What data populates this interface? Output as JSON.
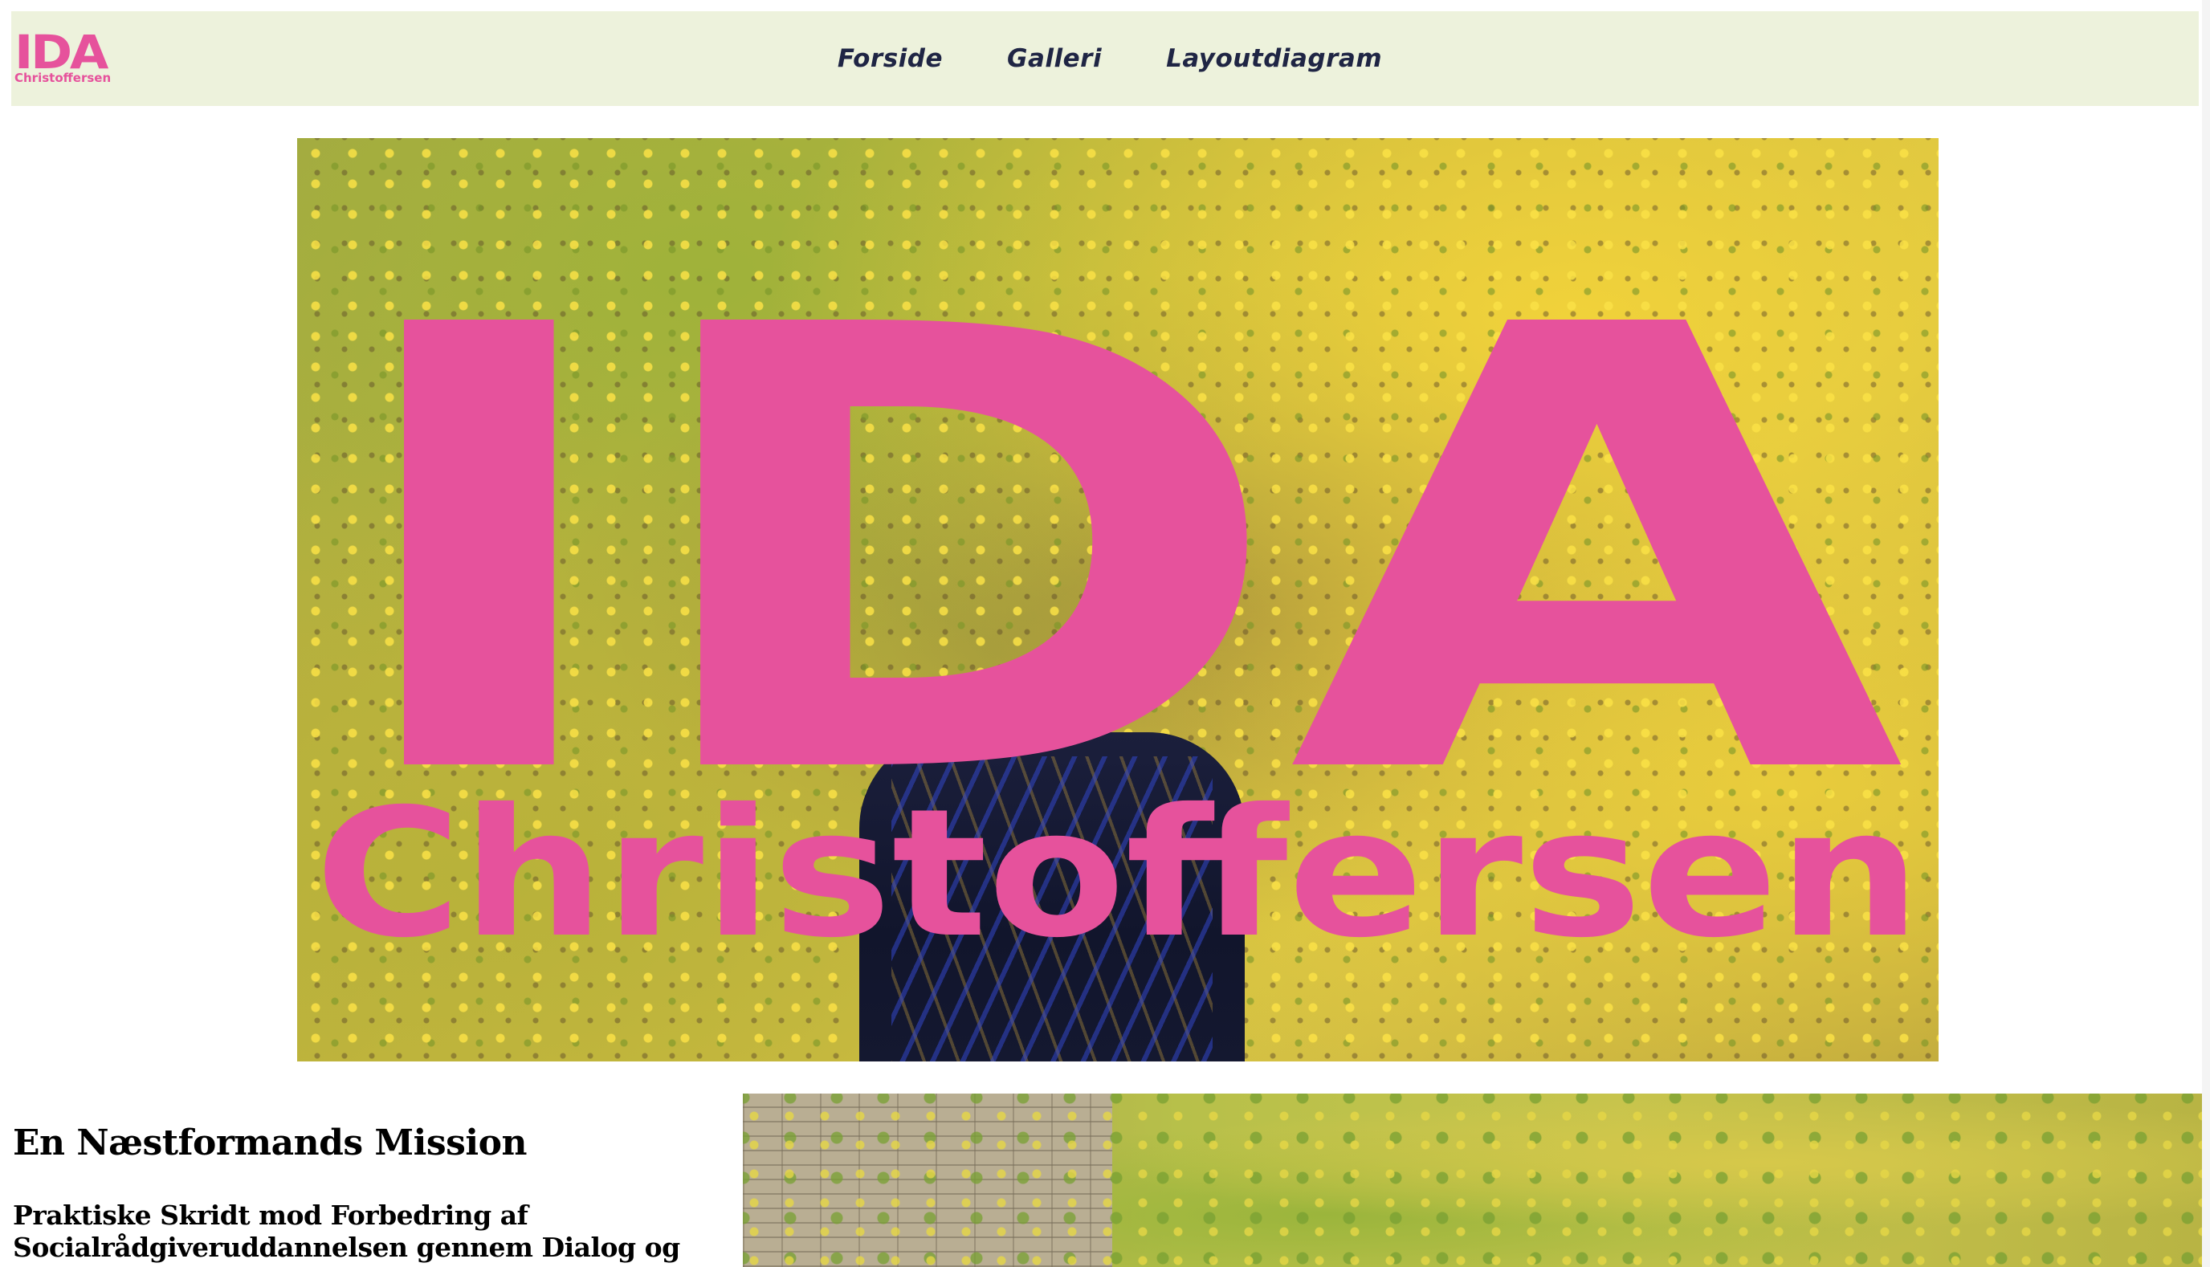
{
  "brand": {
    "logo_big": "IDA",
    "logo_small": "Christoffersen",
    "brand_color": "#e6529c"
  },
  "nav": {
    "items": [
      {
        "label": "Forside"
      },
      {
        "label": "Galleri"
      },
      {
        "label": "Layoutdiagram"
      }
    ],
    "background": "#edf2dc",
    "text_color": "#1f2544"
  },
  "hero": {
    "title": "IDA",
    "subtitle": "Christoffersen",
    "overlay_color": "#e6529c"
  },
  "mission": {
    "title": "En Næstformands Mission",
    "subtitle_line1": "Praktiske Skridt mod Forbedring af",
    "subtitle_line2": "Socialrådgiveruddannelsen gennem Dialog og Handling"
  }
}
